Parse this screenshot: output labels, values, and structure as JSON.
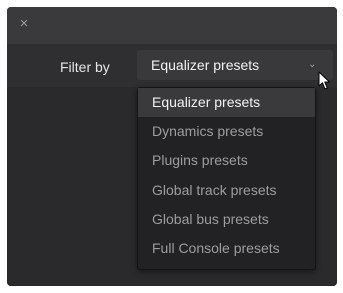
{
  "window": {
    "close_glyph": "×"
  },
  "filter": {
    "label": "Filter by",
    "selected_value": "Equalizer presets",
    "chevron_glyph": "⌄"
  },
  "menu": {
    "items": [
      {
        "label": "Equalizer presets",
        "selected": true
      },
      {
        "label": "Dynamics presets",
        "selected": false
      },
      {
        "label": "Plugins presets",
        "selected": false
      },
      {
        "label": "Global track presets",
        "selected": false
      },
      {
        "label": "Global bus presets",
        "selected": false
      },
      {
        "label": "Full Console presets",
        "selected": false
      }
    ]
  },
  "colors": {
    "window_bg": "#2b2b2d",
    "titlebar_bg": "#3a3a3c",
    "menu_bg": "#222224",
    "selected_item_bg": "#3a3a3c",
    "text_primary": "#f2f2f2",
    "text_muted": "#9d9d9f"
  }
}
